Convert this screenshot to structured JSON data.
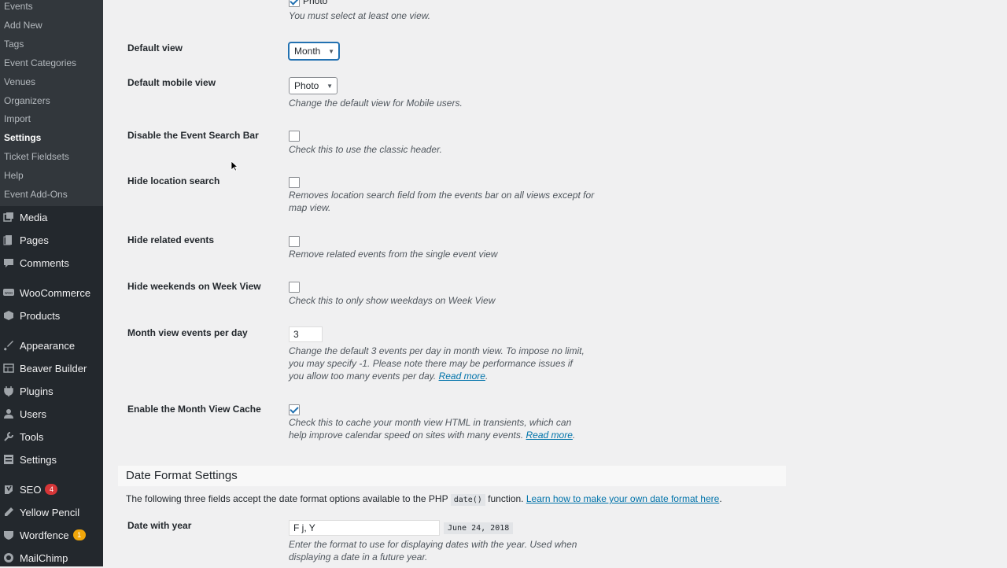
{
  "sidebar": {
    "submenu": [
      {
        "label": "Events",
        "active": false
      },
      {
        "label": "Add New",
        "active": false
      },
      {
        "label": "Tags",
        "active": false
      },
      {
        "label": "Event Categories",
        "active": false
      },
      {
        "label": "Venues",
        "active": false
      },
      {
        "label": "Organizers",
        "active": false
      },
      {
        "label": "Import",
        "active": false
      },
      {
        "label": "Settings",
        "active": true
      },
      {
        "label": "Ticket Fieldsets",
        "active": false
      },
      {
        "label": "Help",
        "active": false
      },
      {
        "label": "Event Add-Ons",
        "active": false
      }
    ],
    "menu": [
      {
        "label": "Media",
        "icon": "media-icon"
      },
      {
        "label": "Pages",
        "icon": "pages-icon"
      },
      {
        "label": "Comments",
        "icon": "comments-icon"
      },
      {
        "label": "WooCommerce",
        "icon": "woocommerce-icon"
      },
      {
        "label": "Products",
        "icon": "products-icon"
      },
      {
        "label": "Appearance",
        "icon": "appearance-icon"
      },
      {
        "label": "Beaver Builder",
        "icon": "beaver-builder-icon"
      },
      {
        "label": "Plugins",
        "icon": "plugins-icon"
      },
      {
        "label": "Users",
        "icon": "users-icon"
      },
      {
        "label": "Tools",
        "icon": "tools-icon"
      },
      {
        "label": "Settings",
        "icon": "settings-icon"
      },
      {
        "label": "SEO",
        "icon": "seo-icon",
        "badge": "4",
        "badge_color": "#d63638"
      },
      {
        "label": "Yellow Pencil",
        "icon": "pencil-icon"
      },
      {
        "label": "Wordfence",
        "icon": "wordfence-icon",
        "badge": "1",
        "badge_color": "#f0a60a"
      },
      {
        "label": "MailChimp",
        "icon": "mailchimp-icon"
      }
    ]
  },
  "settings": {
    "photo_view_label": "Photo",
    "views_note": "You must select at least one view.",
    "default_view": {
      "label": "Default view",
      "value": "Month"
    },
    "default_mobile_view": {
      "label": "Default mobile view",
      "value": "Photo",
      "desc": "Change the default view for Mobile users."
    },
    "disable_search_bar": {
      "label": "Disable the Event Search Bar",
      "checked": false,
      "desc": "Check this to use the classic header."
    },
    "hide_location_search": {
      "label": "Hide location search",
      "checked": false,
      "desc": "Removes location search field from the events bar on all views except for map view."
    },
    "hide_related_events": {
      "label": "Hide related events",
      "checked": false,
      "desc": "Remove related events from the single event view"
    },
    "hide_weekends": {
      "label": "Hide weekends on Week View",
      "checked": false,
      "desc": "Check this to only show weekdays on Week View"
    },
    "month_events_per_day": {
      "label": "Month view events per day",
      "value": "3",
      "desc": "Change the default 3 events per day in month view. To impose no limit, you may specify -1. Please note there may be performance issues if you allow too many events per day.",
      "link": "Read more"
    },
    "month_view_cache": {
      "label": "Enable the Month View Cache",
      "checked": true,
      "desc": "Check this to cache your month view HTML in transients, which can help improve calendar speed on sites with many events.",
      "link": "Read more"
    }
  },
  "date_format": {
    "title": "Date Format Settings",
    "intro_before": "The following three fields accept the date format options available to the PHP ",
    "intro_code": "date()",
    "intro_after": " function. ",
    "intro_link": "Learn how to make your own date format here",
    "date_with_year": {
      "label": "Date with year",
      "value": "F j, Y",
      "example": "June 24, 2018",
      "desc": "Enter the format to use for displaying dates with the year. Used when displaying a date in a future year."
    }
  }
}
